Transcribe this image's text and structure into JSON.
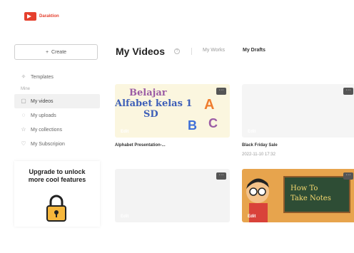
{
  "brand": {
    "name": "Daraktion",
    "color": "#e5402e"
  },
  "create": {
    "label": "Create",
    "icon": "plus-icon"
  },
  "sidebar": {
    "templates": "Templates",
    "section": "Mine",
    "items": [
      {
        "label": "My videos",
        "icon": "video-icon",
        "active": true
      },
      {
        "label": "My uploads",
        "icon": "upload-icon",
        "active": false
      },
      {
        "label": "My collections",
        "icon": "star-icon",
        "active": false
      },
      {
        "label": "My Subscripion",
        "icon": "heart-icon",
        "active": false
      }
    ]
  },
  "upgrade": {
    "line1": "Upgrade to unlock",
    "line2": "more cool features",
    "icon": "lock-icon"
  },
  "main": {
    "title": "My Videos",
    "tabs": [
      {
        "label": "My Works",
        "active": false
      },
      {
        "label": "My Drafts",
        "active": true
      }
    ]
  },
  "cards": [
    {
      "name": "Alphabet Presentation-...",
      "date": "",
      "edit": "Edit",
      "more": "···",
      "thumb_lines": [
        "Belajar",
        "Alfabet kelas 1",
        "SD"
      ],
      "thumb_letters": [
        "A",
        "B",
        "C"
      ]
    },
    {
      "name": "Black Friday Sale",
      "date": "2022-11-10 17:32",
      "edit": "Edit",
      "more": "···"
    },
    {
      "name": "",
      "date": "",
      "edit": "Edit",
      "more": "···"
    },
    {
      "name": "",
      "date": "",
      "edit": "Edit",
      "more": "···",
      "thumb_lines": [
        "How To",
        "Take Notes"
      ]
    }
  ]
}
